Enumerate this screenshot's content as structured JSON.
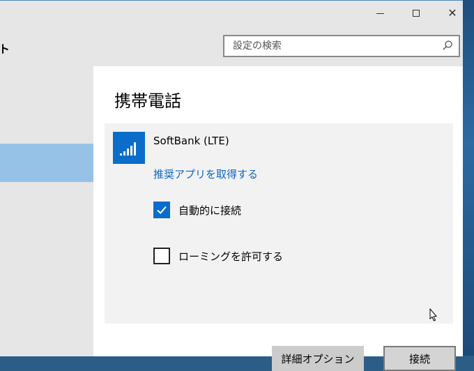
{
  "window": {
    "header_title": "ト"
  },
  "search": {
    "placeholder": "設定の検索"
  },
  "page": {
    "title": "携帯電話"
  },
  "network": {
    "name": "SoftBank (LTE)",
    "app_link": "推奨アプリを取得する",
    "auto_connect": {
      "label": "自動的に接続",
      "checked": true
    },
    "roaming": {
      "label": "ローミングを許可する",
      "checked": false
    }
  },
  "buttons": {
    "advanced": "詳細オプション",
    "connect": "接続"
  },
  "colors": {
    "accent": "#0a6dc9",
    "selected_nav": "#97c2e8",
    "link": "#0a66c2"
  }
}
